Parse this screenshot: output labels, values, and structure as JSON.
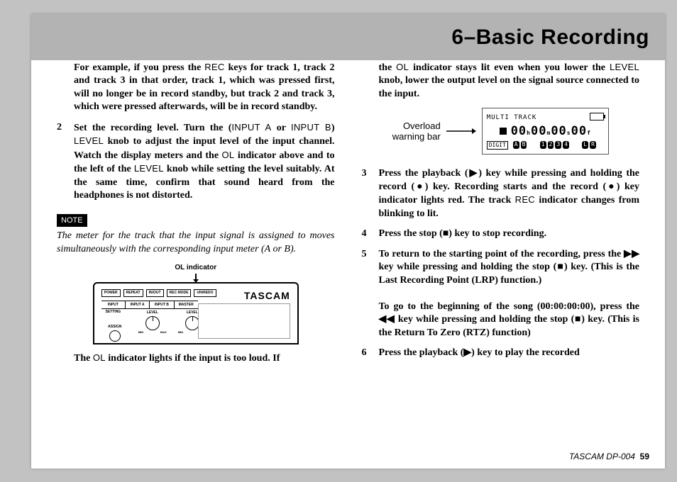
{
  "header": {
    "title": "6–Basic Recording"
  },
  "col1": {
    "p1_a": "For example, if you press the ",
    "p1_rec": "REC",
    "p1_b": " keys for track 1, track 2 and track 3 in that order, track 1, which was pressed first, will no longer be in record standby, but track 2 and track 3, which were pressed afterwards, will be in record standby.",
    "step2_num": "2",
    "step2_a": "Set the recording level. Turn the (",
    "step2_ina": "INPUT A",
    "step2_b": " or ",
    "step2_inb": "INPUT B",
    "step2_c": ") ",
    "step2_level": "LEVEL",
    "step2_d": " knob to adjust the input level of the input channel. Watch the display meters and the ",
    "step2_ol": "OL",
    "step2_e": " indicator above and to the left of the ",
    "step2_level2": "LEVEL",
    "step2_f": " knob while setting the level suitably. At the same time, confirm that sound heard from the headphones is not distorted.",
    "note_tag": "NOTE",
    "note_body": "The meter for the track that the input signal is assigned to moves simultaneously with the corresponding input meter (A or B).",
    "fig1_label": "OL indicator",
    "brand": "TASCAM",
    "btns": [
      "POWER",
      "REPEAT",
      "IN/OUT",
      "REC MODE",
      "UN/REDO"
    ],
    "strip": [
      "INPUT SETTING",
      "INPUT A",
      "INPUT B",
      "MASTER"
    ],
    "klab": "LEVEL",
    "min": "MIN",
    "max": "MAX",
    "assign": "ASSIGN",
    "p_bottom_a": "The ",
    "p_bottom_ol": "OL",
    "p_bottom_b": " indicator lights if the input is too loud. If"
  },
  "col2": {
    "p1_a": "the ",
    "p1_ol": "OL",
    "p1_b": " indicator stays lit even when you lower the ",
    "p1_level": "LEVEL",
    "p1_c": " knob, lower the output level on the signal source connected to the input.",
    "fig2_label1": "Overload",
    "fig2_label2": "warning bar",
    "lcd_title": "MULTI TRACK",
    "lcd_time_h": "00",
    "lcd_time_m": "00",
    "lcd_time_s": "00",
    "lcd_time_f": "00",
    "lcd_h": "h",
    "lcd_m": "m",
    "lcd_s": "s",
    "lcd_f": "f",
    "lcd_tag": "DIGIT",
    "lcd_ab_a": "A",
    "lcd_ab_b": "B",
    "lcd_1": "1",
    "lcd_2": "2",
    "lcd_3": "3",
    "lcd_4": "4",
    "lcd_l": "L",
    "lcd_r": "R",
    "s3_num": "3",
    "s3": "Press the playback (▶) key while pressing and holding the record (●) key. Recording starts and the record (●) key indicator lights red. The track ",
    "s3_rec": "REC",
    "s3b": " indicator changes from blinking to lit.",
    "s4_num": "4",
    "s4": "Press the stop (■) key to stop recording.",
    "s5_num": "5",
    "s5": "To return to the starting point of the recording, press the  ▶▶  key while pressing and holding the stop (■) key. (This is the Last Recording Point (LRP) function.)",
    "s5b": "To go to the beginning of the song (00:00:00:00), press the  ◀◀  key while pressing and holding the stop (■) key. (This is the Return To Zero (RTZ) function)",
    "s6_num": "6",
    "s6": "Press the playback (▶) key to play the recorded"
  },
  "footer": {
    "model": "TASCAM  DP-004",
    "page": "59"
  }
}
